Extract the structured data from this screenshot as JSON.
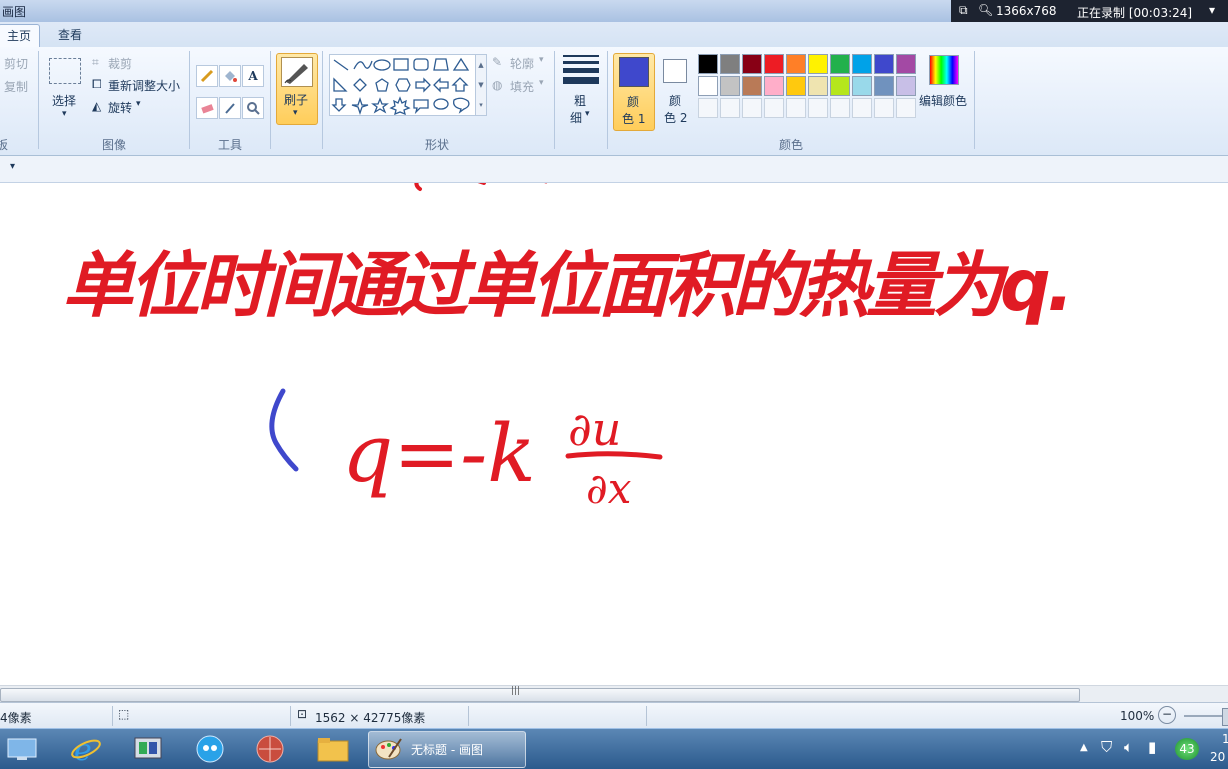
{
  "titlebar": {
    "title": "画图"
  },
  "recorder": {
    "resolution": "1366x768",
    "status": "正在录制 [00:03:24]"
  },
  "tabs": [
    {
      "label": "主页",
      "active": true
    },
    {
      "label": "查看",
      "active": false
    }
  ],
  "ribbon": {
    "clipboard": {
      "cut": "剪切",
      "copy": "复制",
      "group_label": "板"
    },
    "image": {
      "select": "选择",
      "crop": "裁剪",
      "resize": "重新调整大小",
      "rotate": "旋转",
      "group_label": "图像"
    },
    "tools": {
      "group_label": "工具",
      "text_tool": "A"
    },
    "brushes": {
      "label": "刷子"
    },
    "shapes": {
      "outline": "轮廓",
      "fill": "填充",
      "group_label": "形状"
    },
    "size": {
      "label_line1": "粗",
      "label_line2": "细"
    },
    "color1": {
      "line1": "颜",
      "line2": "色 1",
      "value": "#3f48cc"
    },
    "color2": {
      "line1": "颜",
      "line2": "色 2",
      "value": "#ffffff"
    },
    "edit_colors": "编辑颜色",
    "colors_group_label": "颜色",
    "palette_row1": [
      "#000000",
      "#7f7f7f",
      "#880015",
      "#ed1c24",
      "#ff7f27",
      "#fff200",
      "#22b14c",
      "#00a2e8",
      "#3f48cc",
      "#a349a4"
    ],
    "palette_row2": [
      "#ffffff",
      "#c3c3c3",
      "#b97a57",
      "#ffaec9",
      "#ffc90e",
      "#efe4b0",
      "#b5e61d",
      "#99d9ea",
      "#7092be",
      "#c8bfe7"
    ]
  },
  "canvas": {
    "line1": "单位时间通过单位面积的热量为q.",
    "eq_lhs": "q=-k",
    "frac_num": "∂u",
    "frac_den": "∂x",
    "ink_red": "#e01b24",
    "ink_blue": "#3f48cc"
  },
  "statusbar": {
    "position": "4像素",
    "canvas_size": "1562 × 42775像素",
    "zoom": "100%"
  },
  "taskbar": {
    "paint_label": "无标题 - 画图",
    "tray_number": "43",
    "clock_a": "1",
    "clock_b": "20"
  }
}
